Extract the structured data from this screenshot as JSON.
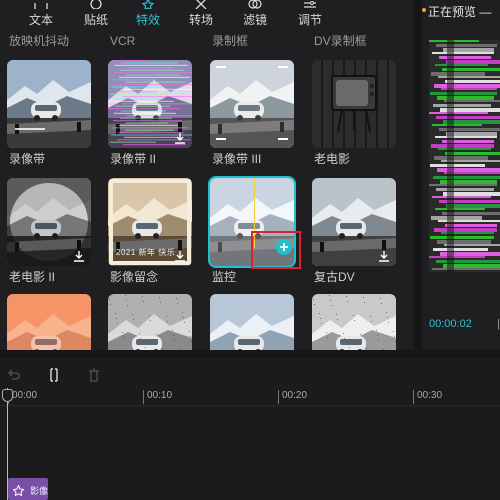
{
  "toolbar": {
    "items": [
      {
        "label": "文本",
        "icon": "text-icon",
        "active": false
      },
      {
        "label": "贴纸",
        "icon": "sticker-icon",
        "active": false
      },
      {
        "label": "特效",
        "icon": "effects-icon",
        "active": true
      },
      {
        "label": "转场",
        "icon": "transition-icon",
        "active": false
      },
      {
        "label": "滤镜",
        "icon": "filter-icon",
        "active": false
      },
      {
        "label": "调节",
        "icon": "adjust-icon",
        "active": false
      }
    ]
  },
  "sections": [
    "放映机抖动",
    "VCR",
    "录制框",
    "DV录制框"
  ],
  "effects": [
    {
      "label": "录像带",
      "style": "vhs",
      "download": false,
      "overlay": ""
    },
    {
      "label": "录像带 II",
      "style": "noise",
      "download": true,
      "overlay": ""
    },
    {
      "label": "录像带 III",
      "style": "rec",
      "download": false,
      "overlay": ""
    },
    {
      "label": "老电影",
      "style": "tv",
      "download": false,
      "overlay": ""
    },
    {
      "label": "老电影 II",
      "style": "bw",
      "download": true,
      "overlay": ""
    },
    {
      "label": "影像留念",
      "style": "sepia",
      "download": true,
      "overlay": "2021 新年 快乐"
    },
    {
      "label": "监控",
      "style": "monitor",
      "download": false,
      "overlay": ""
    },
    {
      "label": "复古DV",
      "style": "retro",
      "download": true,
      "overlay": ""
    },
    {
      "label": "",
      "style": "warm",
      "download": false,
      "overlay": ""
    },
    {
      "label": "",
      "style": "grain",
      "download": false,
      "overlay": ""
    },
    {
      "label": "",
      "style": "fade",
      "download": false,
      "overlay": ""
    },
    {
      "label": "",
      "style": "dust",
      "download": false,
      "overlay": ""
    }
  ],
  "preview": {
    "title": "正在预览 —",
    "time": "00:00:02",
    "separator": "|"
  },
  "timeline": {
    "ticks": [
      "00:00",
      "00:10",
      "00:20",
      "00:30"
    ],
    "clip_label": "影像"
  },
  "colors": {
    "accent": "#27c6d6",
    "highlight_box": "#e0202a",
    "clip": "#7a4fa8"
  }
}
